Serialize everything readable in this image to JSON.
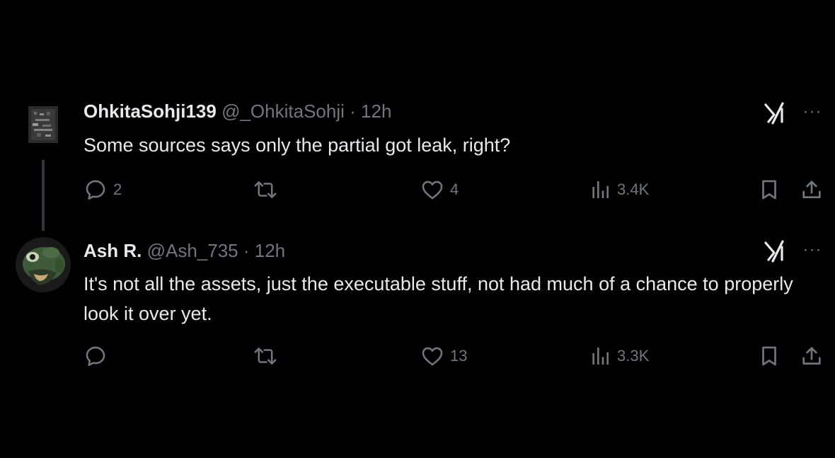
{
  "tweets": [
    {
      "display_name": "OhkitaSohji139",
      "handle": "@_OhkitaSohji",
      "separator": "·",
      "time": "12h",
      "text": "Some sources says only the partial got leak, right?",
      "replies": "2",
      "retweets": "",
      "likes": "4",
      "views": "3.4K",
      "avatar_icon": "pixel-art-avatar",
      "more_icon": "ellipsis-icon"
    },
    {
      "display_name": "Ash R.",
      "handle": "@Ash_735",
      "separator": "·",
      "time": "12h",
      "text": "It's not all the assets, just the executable stuff, not had much of a chance to properly look it over yet.",
      "replies": "",
      "retweets": "",
      "likes": "13",
      "views": "3.3K",
      "avatar_icon": "green-creature-avatar",
      "more_icon": "ellipsis-icon"
    }
  ],
  "icons": {
    "reply": "speech-bubble-icon",
    "retweet": "retweet-arrows-icon",
    "like": "heart-icon",
    "views": "bar-chart-icon",
    "bookmark": "bookmark-icon",
    "share": "share-upload-icon",
    "grok": "grok-slash-icon"
  },
  "colors": {
    "background": "#000000",
    "primary_text": "#e7e9ea",
    "secondary_text": "#71767b",
    "thread_line": "#333639"
  }
}
